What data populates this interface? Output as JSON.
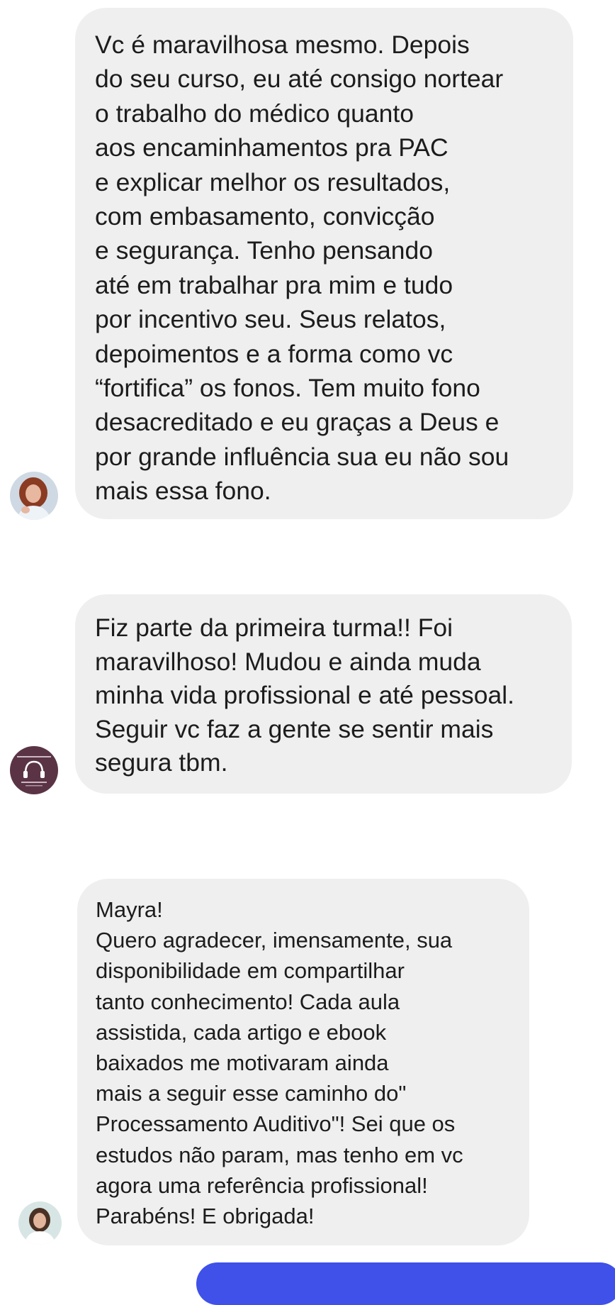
{
  "theme": {
    "bubble_bg": "#efefef",
    "text_color": "#1c1c1c",
    "accent": "#3f51e8",
    "avatar2_bg": "#5a3445"
  },
  "messages": [
    {
      "avatar": "profile-photo-woman-red-hair",
      "text": "Vc é maravilhosa mesmo. Depois\ndo seu curso, eu até consigo nortear\no trabalho do médico quanto\naos encaminhamentos pra PAC\ne explicar melhor os resultados,\ncom embasamento, convicção\ne segurança. Tenho pensando\naté em trabalhar pra mim e tudo\npor incentivo seu. Seus relatos,\ndepoimentos e a forma como vc\n“fortifica” os fonos. Tem muito fono\ndesacreditado e eu graças a Deus e\npor grande influência sua eu não sou\nmais essa fono."
    },
    {
      "avatar": "fonoaudiology-logo-headphones",
      "text": "Fiz parte da primeira turma!! Foi\nmaravilhoso! Mudou e ainda muda\nminha vida profissional e até pessoal.\nSeguir vc faz a gente se sentir mais\nsegura tbm."
    },
    {
      "avatar": "profile-photo-woman-white-shirt",
      "text": "Mayra!\nQuero agradecer, imensamente, sua\ndisponibilidade em compartilhar\ntanto conhecimento! Cada aula\nassistida, cada artigo e ebook\nbaixados me motivaram ainda\nmais a seguir esse caminho do\"\nProcessamento Auditivo\"!  Sei que os\nestudos não param, mas tenho em vc\nagora  uma referência profissional!\nParabéns! E obrigada!"
    }
  ]
}
